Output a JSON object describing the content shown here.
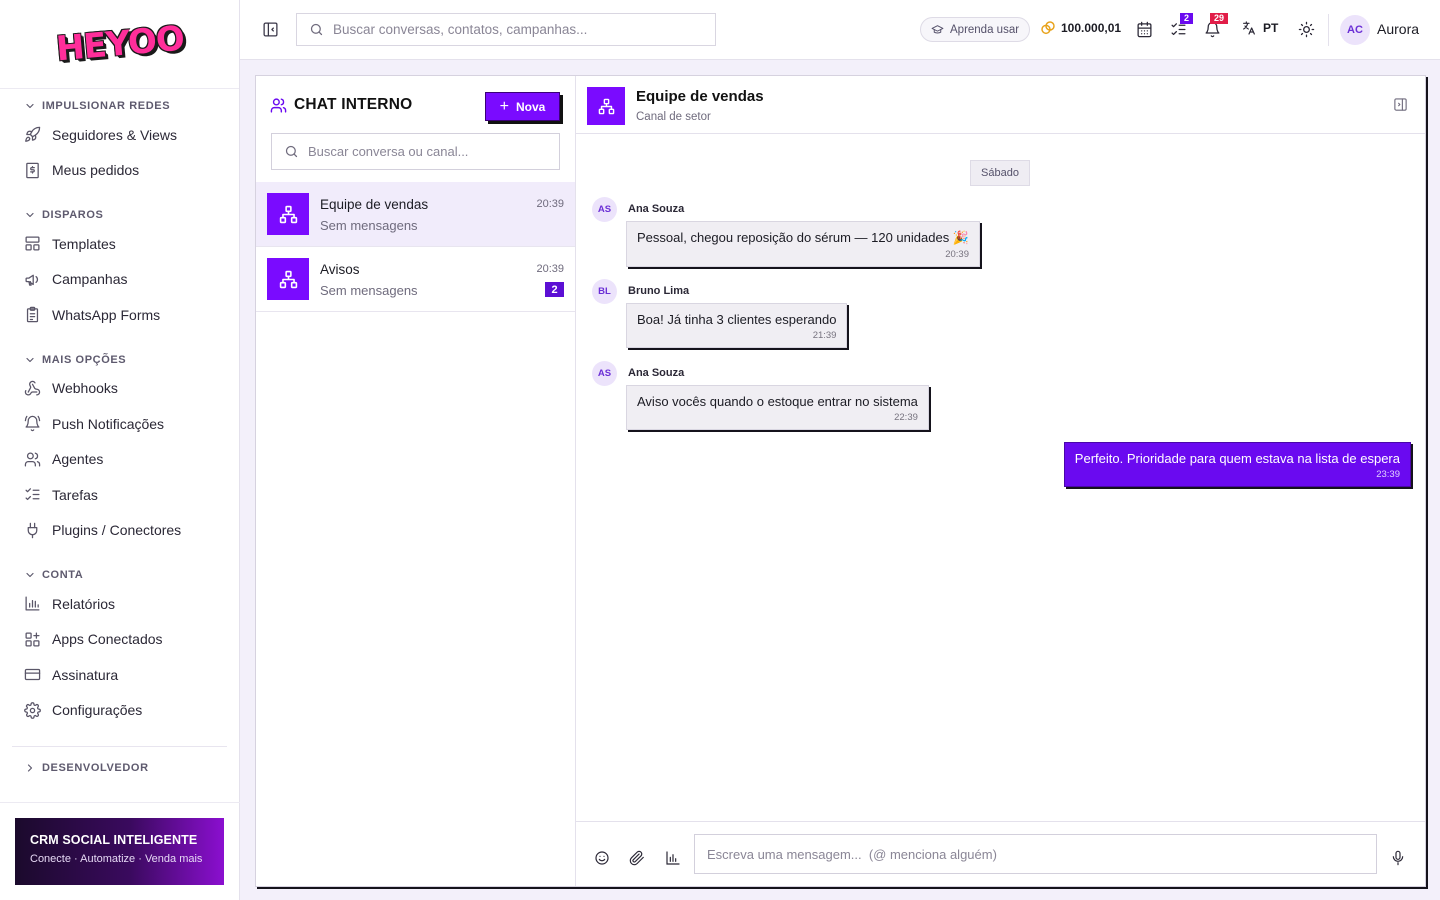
{
  "brand": {
    "logo_text": "HEYOO"
  },
  "sidebar": {
    "sections": [
      {
        "label": "IMPULSIONAR REDES",
        "items": [
          {
            "label": "Seguidores & Views",
            "icon": "rocket-icon"
          },
          {
            "label": "Meus pedidos",
            "icon": "receipt-icon"
          }
        ]
      },
      {
        "label": "DISPAROS",
        "items": [
          {
            "label": "Templates",
            "icon": "layout-icon"
          },
          {
            "label": "Campanhas",
            "icon": "megaphone-icon"
          },
          {
            "label": "WhatsApp Forms",
            "icon": "clipboard-icon"
          }
        ]
      },
      {
        "label": "MAIS OPÇÕES",
        "items": [
          {
            "label": "Webhooks",
            "icon": "webhook-icon"
          },
          {
            "label": "Push Notificações",
            "icon": "bell-ring-icon"
          },
          {
            "label": "Agentes",
            "icon": "users-icon"
          },
          {
            "label": "Tarefas",
            "icon": "list-checks-icon"
          },
          {
            "label": "Plugins / Conectores",
            "icon": "plug-icon"
          }
        ]
      },
      {
        "label": "CONTA",
        "items": [
          {
            "label": "Relatórios",
            "icon": "bar-chart-icon"
          },
          {
            "label": "Apps Conectados",
            "icon": "apps-icon"
          },
          {
            "label": "Assinatura",
            "icon": "credit-card-icon"
          },
          {
            "label": "Configurações",
            "icon": "gear-icon"
          }
        ]
      }
    ],
    "developer": {
      "label": "DESENVOLVEDOR"
    },
    "promo": {
      "title": "CRM SOCIAL INTELIGENTE",
      "subtitle": "Conecte · Automatize · Venda mais"
    }
  },
  "topbar": {
    "search_placeholder": "Buscar conversas, contatos, campanhas...",
    "learn_label": "Aprenda usar",
    "credits": "100.000,01",
    "tasks_badge": "2",
    "notifications_badge": "29",
    "language": "PT",
    "user": {
      "initials": "AC",
      "name": "Aurora"
    }
  },
  "chat_list": {
    "title": "CHAT INTERNO",
    "new_button": "Nova",
    "search_placeholder": "Buscar conversa ou canal...",
    "conversations": [
      {
        "name": "Equipe de vendas",
        "preview": "Sem mensagens",
        "time": "20:39",
        "unread": "",
        "active": true
      },
      {
        "name": "Avisos",
        "preview": "Sem mensagens",
        "time": "20:39",
        "unread": "2",
        "active": false
      }
    ]
  },
  "chat": {
    "title": "Equipe de vendas",
    "subtitle": "Canal de setor",
    "date_separator": "Sábado",
    "messages": [
      {
        "author": "Ana Souza",
        "initials": "AS",
        "text": "Pessoal, chegou reposição do sérum — 120 unidades 🎉",
        "time": "20:39",
        "mine": false
      },
      {
        "author": "Bruno Lima",
        "initials": "BL",
        "text": "Boa! Já tinha 3 clientes esperando",
        "time": "21:39",
        "mine": false
      },
      {
        "author": "Ana Souza",
        "initials": "AS",
        "text": "Aviso vocês quando o estoque entrar no sistema",
        "time": "22:39",
        "mine": false
      },
      {
        "author": "",
        "initials": "",
        "text": "Perfeito. Prioridade para quem estava na lista de espera",
        "time": "23:39",
        "mine": true
      }
    ],
    "composer_placeholder": "Escreva uma mensagem...  (@ menciona alguém)"
  },
  "colors": {
    "accent": "#7a0bff",
    "accent_dark": "#5c0fd4",
    "brand_pink": "#ff2e9a",
    "badge_red": "#e11d48"
  }
}
